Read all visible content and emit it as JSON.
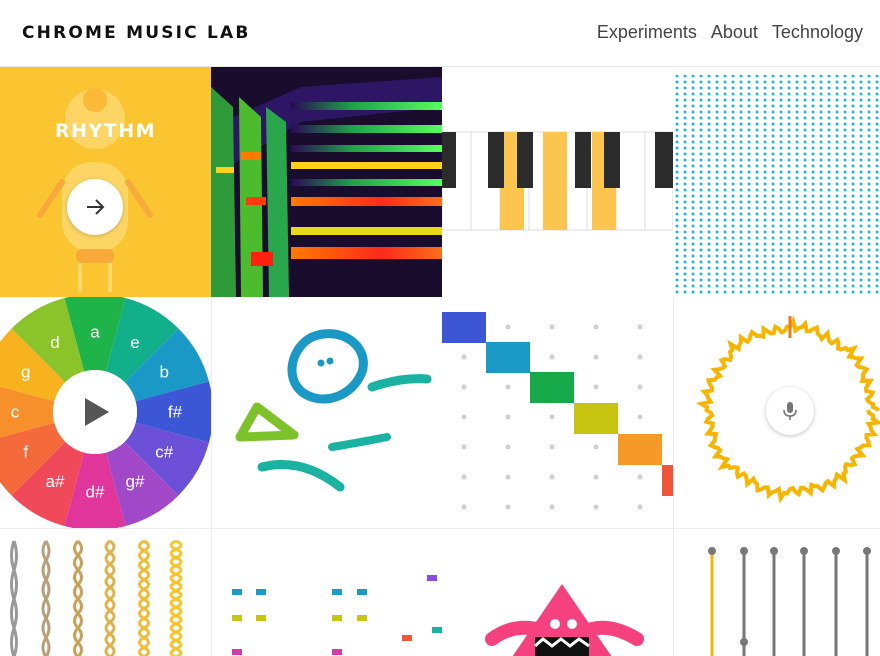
{
  "header": {
    "brand": "CHROME MUSIC LAB",
    "nav": [
      {
        "label": "Experiments"
      },
      {
        "label": "About"
      },
      {
        "label": "Technology"
      }
    ]
  },
  "experiments": {
    "rhythm": {
      "title": "RHYTHM",
      "color": "#fbc531",
      "icon": "arrow-right-icon"
    },
    "chords": {
      "notes": [
        "a",
        "e",
        "b",
        "f#",
        "c#",
        "g#",
        "d#",
        "a#",
        "f",
        "c",
        "g",
        "d"
      ]
    },
    "voice_spinner": {
      "icon": "microphone-icon"
    }
  },
  "colors": {
    "rhythm_yellow": "#fbc531",
    "piano_yellow": "#fbc54f",
    "dot_blue": "#20b5e2",
    "voice_ring": "#f7b500",
    "doodle_blue": "#1a99c7",
    "doodle_green": "#7dc22a",
    "doodle_teal": "#1ab2a0",
    "monster_pink": "#f5417d"
  }
}
